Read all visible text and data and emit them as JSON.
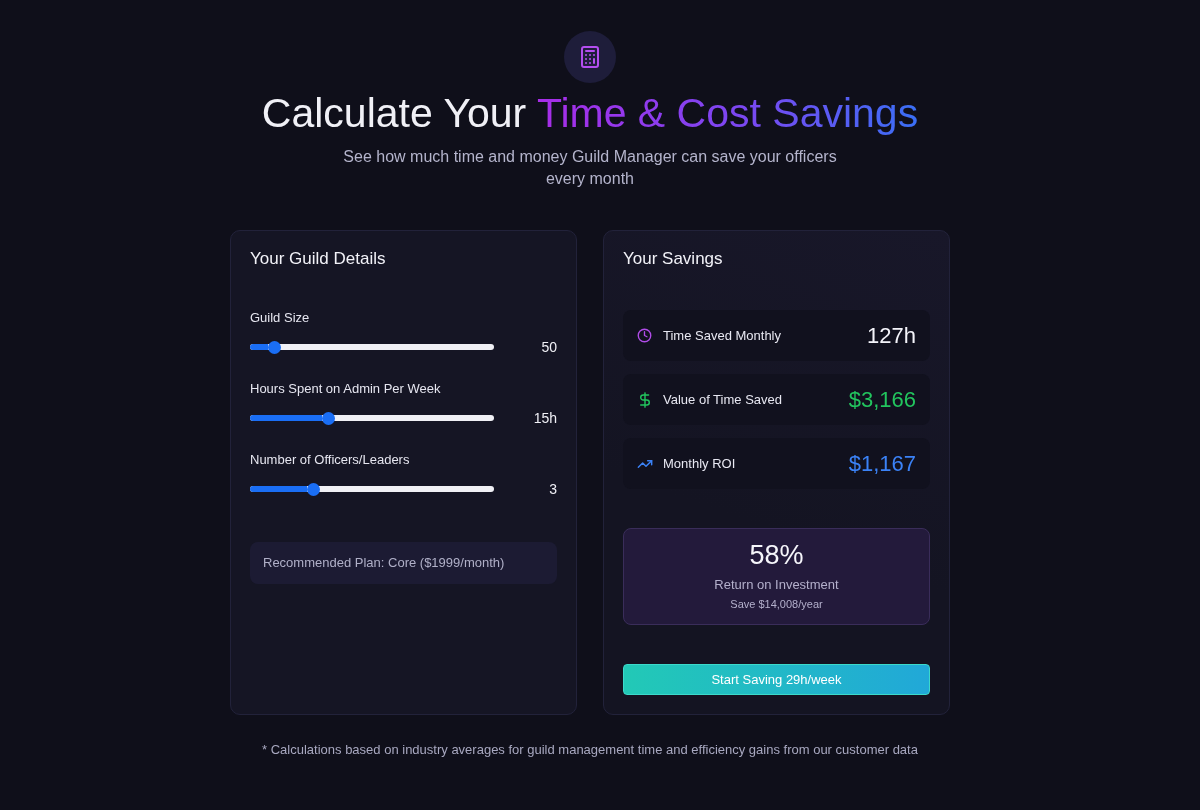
{
  "header": {
    "title": {
      "text": "Calculate Your",
      "highlight": "Time & Cost Savings"
    },
    "subtitle": "See how much time and money Guild Manager can save your officers every month"
  },
  "details": {
    "title": "Your Guild Details",
    "sliders": [
      {
        "label": "Guild Size",
        "level": 0.1,
        "reading": "50"
      },
      {
        "label": "Hours Spent on Admin Per Week",
        "level": 0.32,
        "reading": "15h"
      },
      {
        "label": "Number of Officers/Leaders",
        "level": 0.26,
        "reading": "3"
      }
    ],
    "recommendation": "Recommended Plan: Core ($1999/month)"
  },
  "savings": {
    "title": "Your Savings",
    "metrics": [
      {
        "kind": "clock",
        "label": "Time Saved Monthly",
        "value": "127h",
        "color": "#f4f4fa"
      },
      {
        "kind": "dollar",
        "label": "Value of Time Saved",
        "value": "$3,166",
        "color": "#22c55e"
      },
      {
        "kind": "trend",
        "label": "Monthly ROI",
        "value": "$1,167",
        "color": "#3b82f6"
      }
    ],
    "roi": {
      "value": "58%",
      "label": "Return on Investment",
      "note": "Save $14,008/year"
    },
    "button": "Start Saving 29h/week"
  },
  "footnote": "* Calculations based on industry averages for guild management time and efficiency gains from our customer data"
}
